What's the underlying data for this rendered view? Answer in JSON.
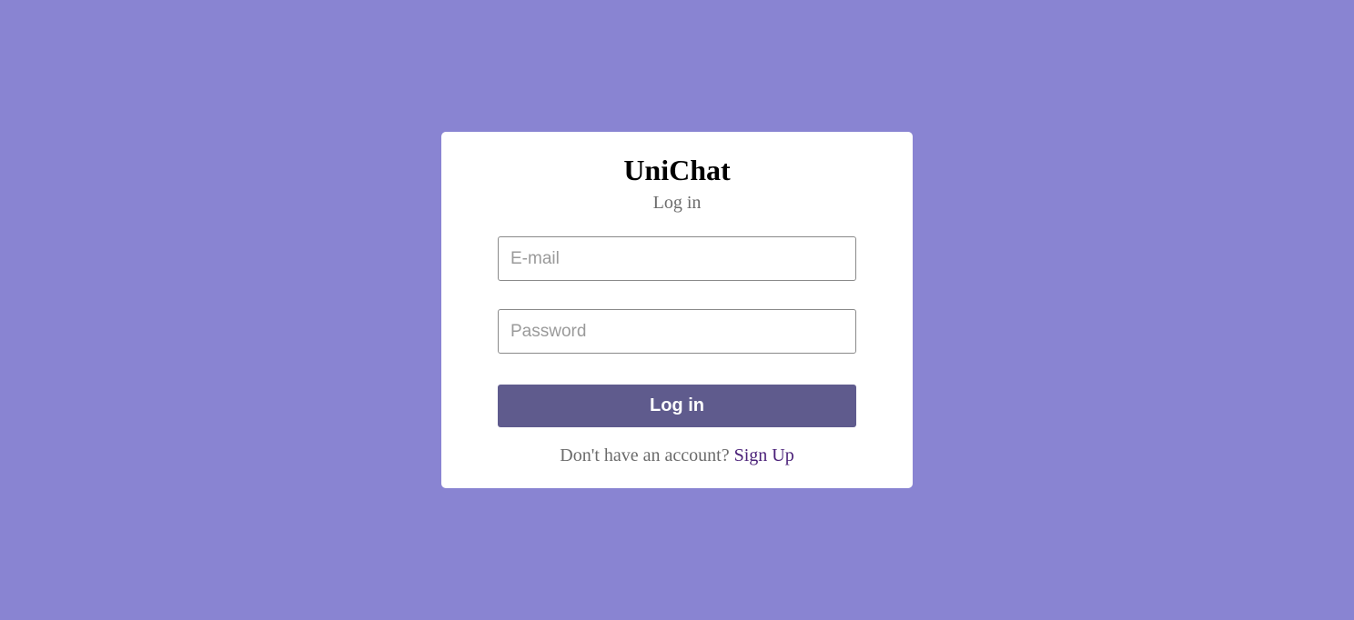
{
  "app": {
    "title": "UniChat",
    "subtitle": "Log in"
  },
  "form": {
    "email_placeholder": "E-mail",
    "email_value": "",
    "password_placeholder": "Password",
    "password_value": "",
    "submit_label": "Log in"
  },
  "footer": {
    "prompt": "Don't have an account?",
    "link_label": "Sign Up"
  },
  "colors": {
    "background": "#8984d2",
    "card": "#ffffff",
    "button": "#5f5b8d",
    "link": "#4a2078"
  }
}
